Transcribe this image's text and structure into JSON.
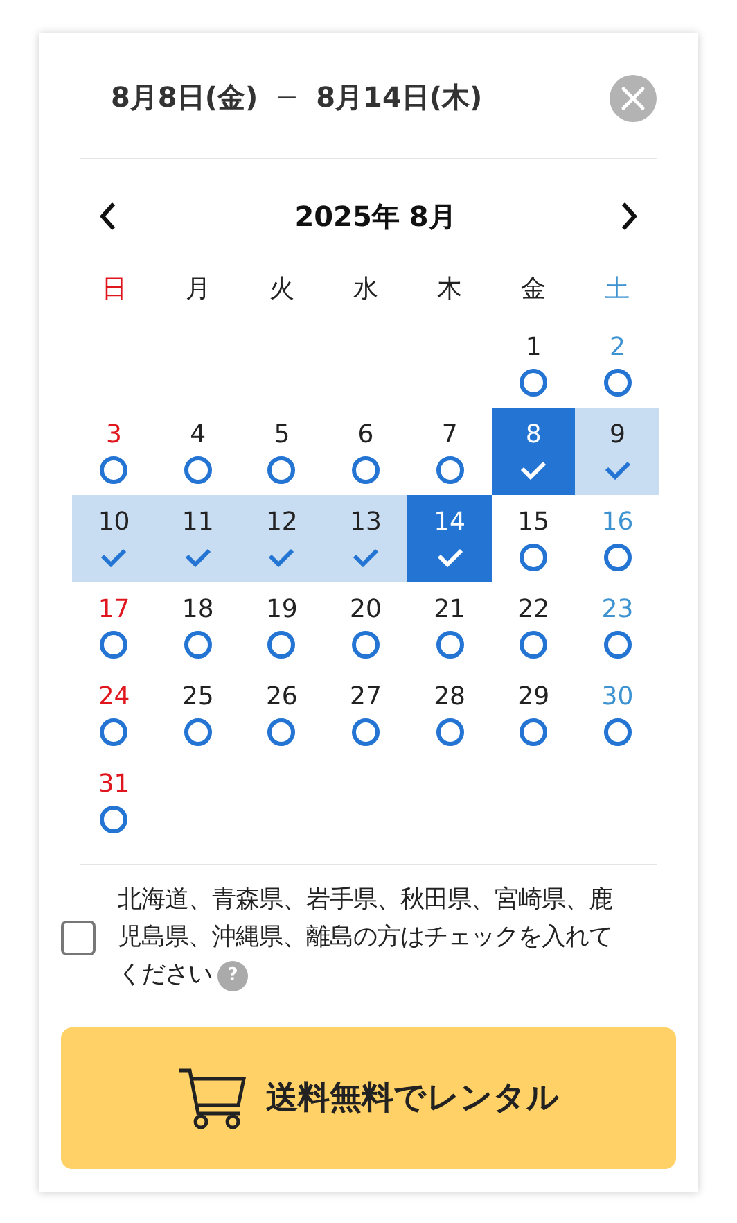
{
  "header": {
    "start_date": "8月8日(金)",
    "separator": "—",
    "end_date": "8月14日(木)"
  },
  "calendar": {
    "month_label": "2025年 8月",
    "weekdays": [
      {
        "label": "日",
        "color": "#e0161e"
      },
      {
        "label": "月",
        "color": "#222222"
      },
      {
        "label": "火",
        "color": "#222222"
      },
      {
        "label": "水",
        "color": "#222222"
      },
      {
        "label": "木",
        "color": "#222222"
      },
      {
        "label": "金",
        "color": "#222222"
      },
      {
        "label": "土",
        "color": "#3d93d1"
      }
    ],
    "weeks": [
      [
        {
          "day": "1",
          "kind": "available"
        },
        {
          "day": "2",
          "kind": "available"
        }
      ],
      [
        {
          "day": "3",
          "kind": "available"
        },
        {
          "day": "4",
          "kind": "available"
        },
        {
          "day": "5",
          "kind": "available"
        },
        {
          "day": "6",
          "kind": "available"
        },
        {
          "day": "7",
          "kind": "available"
        },
        {
          "day": "8",
          "kind": "endpoint"
        },
        {
          "day": "9",
          "kind": "range"
        }
      ],
      [
        {
          "day": "10",
          "kind": "range"
        },
        {
          "day": "11",
          "kind": "range"
        },
        {
          "day": "12",
          "kind": "range"
        },
        {
          "day": "13",
          "kind": "range"
        },
        {
          "day": "14",
          "kind": "endpoint"
        },
        {
          "day": "15",
          "kind": "available"
        },
        {
          "day": "16",
          "kind": "available"
        }
      ],
      [
        {
          "day": "17",
          "kind": "available"
        },
        {
          "day": "18",
          "kind": "available"
        },
        {
          "day": "19",
          "kind": "available"
        },
        {
          "day": "20",
          "kind": "available"
        },
        {
          "day": "21",
          "kind": "available"
        },
        {
          "day": "22",
          "kind": "available"
        },
        {
          "day": "23",
          "kind": "available"
        }
      ],
      [
        {
          "day": "24",
          "kind": "available"
        },
        {
          "day": "25",
          "kind": "available"
        },
        {
          "day": "26",
          "kind": "available"
        },
        {
          "day": "27",
          "kind": "available"
        },
        {
          "day": "28",
          "kind": "available"
        },
        {
          "day": "29",
          "kind": "available"
        },
        {
          "day": "30",
          "kind": "available"
        }
      ],
      [
        {
          "day": "31",
          "kind": "available"
        }
      ]
    ]
  },
  "remote_area": {
    "checked": false,
    "label": "北海道、青森県、岩手県、秋田県、宮崎県、鹿児島県、沖縄県、離島の方はチェックを入れて",
    "label_end": "ください",
    "help": "?"
  },
  "rent_button": {
    "label": "送料無料でレンタル"
  }
}
